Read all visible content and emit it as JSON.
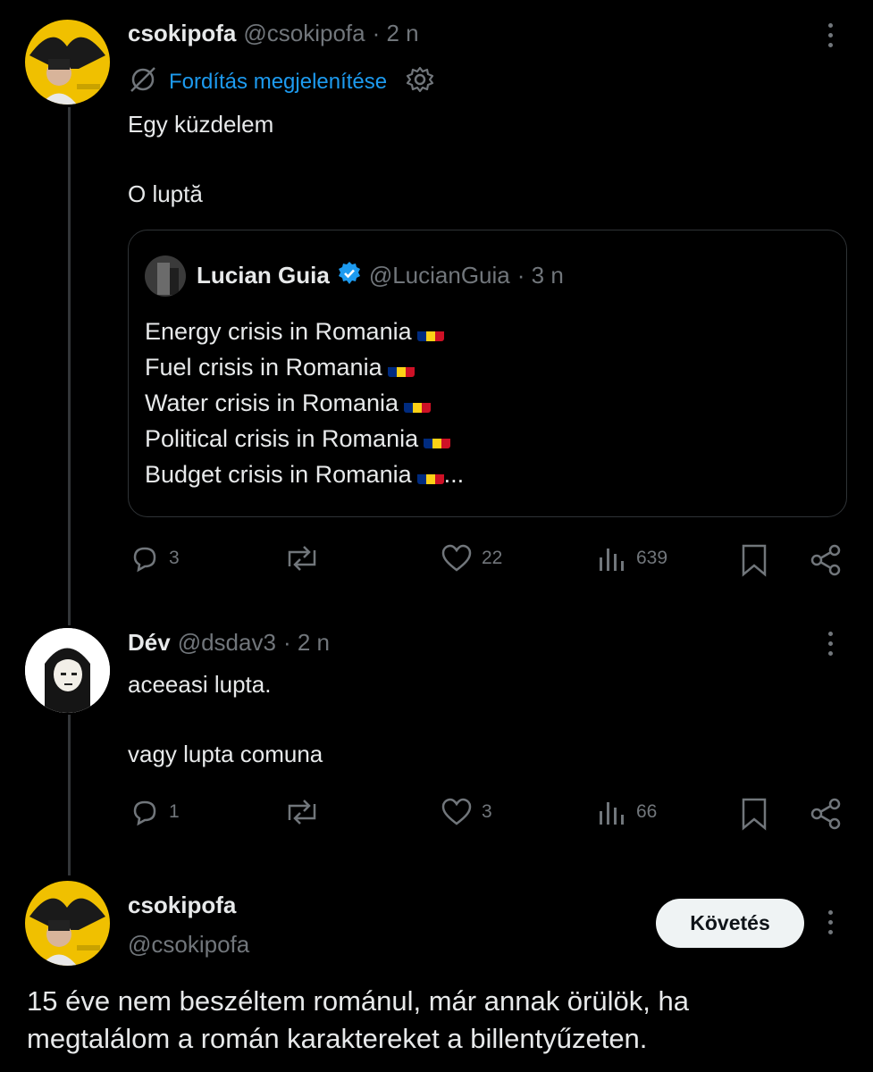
{
  "post1": {
    "author_name": "csokipofa",
    "author_handle": "@csokipofa",
    "time": "· 2 n",
    "translate_label": "Fordítás megjelenítése",
    "text": "Egy küzdelem\n\nO luptă",
    "quote": {
      "author_name": "Lucian Guia",
      "author_handle": "@LucianGuia",
      "time": "· 3 n",
      "lines": [
        "Energy crisis in Romania",
        "Fuel crisis in Romania",
        "Water crisis in Romania",
        "Political crisis in Romania",
        "Budget crisis in Romania"
      ],
      "ellipsis": "..."
    },
    "replies": "3",
    "reposts": "",
    "likes": "22",
    "views": "639"
  },
  "post2": {
    "author_name": "Dév",
    "author_handle": "@dsdav3",
    "time": "· 2 n",
    "text": "aceeasi lupta.\n\nvagy lupta comuna",
    "replies": "1",
    "reposts": "",
    "likes": "3",
    "views": "66"
  },
  "main_post": {
    "author_name": "csokipofa",
    "author_handle": "@csokipofa",
    "follow_label": "Követés",
    "text": "15 éve nem beszéltem románul, már annak örülök, ha megtalálom a román karaktereket a billentyűzeten."
  },
  "colors": {
    "background": "#000000",
    "text": "#e7e9ea",
    "secondary": "#71767b",
    "link": "#1d9bf0",
    "verified": "#1d9bf0",
    "flag_blue": "#002b7f",
    "flag_yellow": "#fcd116",
    "flag_red": "#ce1126"
  },
  "icons": [
    "translate-icon",
    "gear-icon",
    "verified-icon",
    "reply-icon",
    "repost-icon",
    "like-icon",
    "views-icon",
    "bookmark-icon",
    "share-icon",
    "more-icon"
  ]
}
